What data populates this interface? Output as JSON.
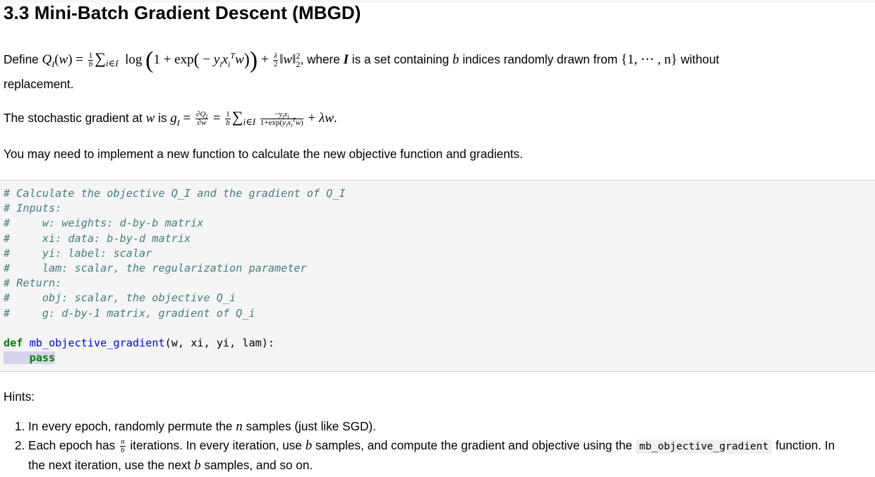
{
  "heading": "3.3 Mini-Batch Gradient Descent (MBGD)",
  "define_paragraph": {
    "prefix": "Define",
    "suffix": ", where",
    "I_symbol": "I",
    "text_a": "is a set containing",
    "b_symbol": "b",
    "text_b": "indices randomly drawn from",
    "set": "{1, ⋯ , n}",
    "text_c": "without",
    "line2": "replacement."
  },
  "gradient_paragraph": {
    "prefix": "The stochastic gradient at",
    "w_symbol": "w",
    "is": "is"
  },
  "note": "You may need to implement a new function to calculate the new objective function and gradients.",
  "code_cell": {
    "comment_lines": [
      "# Calculate the objective Q_I and the gradient of Q_I",
      "# Inputs:",
      "#     w: weights: d-by-b matrix",
      "#     xi: data: b-by-d matrix",
      "#     yi: label: scalar",
      "#     lam: scalar, the regularization parameter",
      "# Return:",
      "#     obj: scalar, the objective Q_i",
      "#     g: d-by-1 matrix, gradient of Q_i"
    ],
    "def_keyword": "def",
    "function_name": "mb_objective_gradient",
    "params": "(w, xi, yi, lam):",
    "body_keyword": "pass"
  },
  "hints": {
    "title": "Hints:",
    "items": [
      {
        "a": "In every epoch, randomly permute the",
        "sym": "n",
        "b": "samples (just like SGD)."
      },
      {
        "a": "Each epoch has",
        "frac_num": "n",
        "frac_den": "b",
        "b": "iterations. In every iteration, use",
        "sym": "b",
        "c": "samples, and compute the gradient and objective using the",
        "code": "mb_objective_gradient",
        "d": "function. In",
        "line2_a": "the next iteration, use the next",
        "line2_sym": "b",
        "line2_b": "samples, and so on."
      }
    ]
  }
}
